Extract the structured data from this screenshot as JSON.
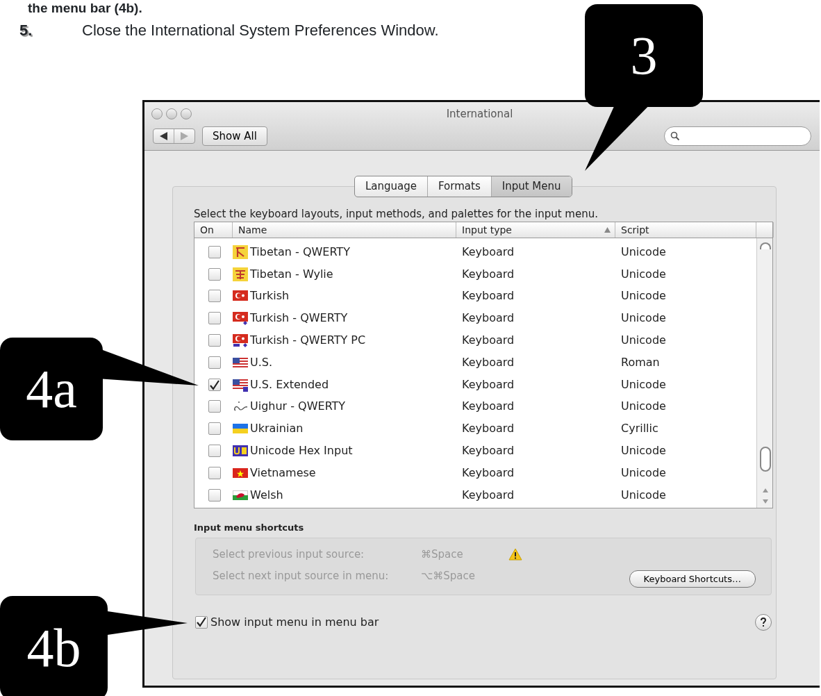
{
  "document": {
    "heading_fragment": "the menu bar (4b).",
    "step": {
      "number": "5.",
      "text": "Close the International System Preferences Window."
    }
  },
  "callouts": [
    {
      "label": "3"
    },
    {
      "label": "4a"
    },
    {
      "label": "4b"
    }
  ],
  "window": {
    "title": "International",
    "show_all": "Show All"
  },
  "tabs": [
    {
      "label": "Language",
      "selected": false
    },
    {
      "label": "Formats",
      "selected": false
    },
    {
      "label": "Input Menu",
      "selected": true
    }
  ],
  "instruction": "Select the keyboard layouts, input methods, and palettes for the input menu.",
  "table": {
    "columns": [
      {
        "label": "On",
        "sorted": false
      },
      {
        "label": "Name",
        "sorted": false
      },
      {
        "label": "Input type",
        "sorted": true
      },
      {
        "label": "Script",
        "sorted": false
      }
    ],
    "rows": [
      {
        "on": false,
        "name": "Tibetan - QWERTY",
        "input_type": "Keyboard",
        "script": "Unicode"
      },
      {
        "on": false,
        "name": "Tibetan - Wylie",
        "input_type": "Keyboard",
        "script": "Unicode"
      },
      {
        "on": false,
        "name": "Turkish",
        "input_type": "Keyboard",
        "script": "Unicode"
      },
      {
        "on": false,
        "name": "Turkish - QWERTY",
        "input_type": "Keyboard",
        "script": "Unicode"
      },
      {
        "on": false,
        "name": "Turkish - QWERTY PC",
        "input_type": "Keyboard",
        "script": "Unicode"
      },
      {
        "on": false,
        "name": "U.S.",
        "input_type": "Keyboard",
        "script": "Roman"
      },
      {
        "on": true,
        "name": "U.S. Extended",
        "input_type": "Keyboard",
        "script": "Unicode"
      },
      {
        "on": false,
        "name": "Uighur - QWERTY",
        "input_type": "Keyboard",
        "script": "Unicode"
      },
      {
        "on": false,
        "name": "Ukrainian",
        "input_type": "Keyboard",
        "script": "Cyrillic"
      },
      {
        "on": false,
        "name": "Unicode Hex Input",
        "input_type": "Keyboard",
        "script": "Unicode"
      },
      {
        "on": false,
        "name": "Vietnamese",
        "input_type": "Keyboard",
        "script": "Unicode"
      },
      {
        "on": false,
        "name": "Welsh",
        "input_type": "Keyboard",
        "script": "Unicode"
      }
    ]
  },
  "shortcuts": {
    "title": "Input menu shortcuts",
    "items": [
      {
        "label": "Select previous input source:",
        "keys": "⌘Space",
        "warning": true,
        "disabled": true
      },
      {
        "label": "Select next input source in menu:",
        "keys": "⌥⌘Space",
        "warning": false,
        "disabled": true
      }
    ],
    "button": "Keyboard Shortcuts…"
  },
  "show_input_menu": {
    "label": "Show input menu in menu bar",
    "checked": true
  }
}
